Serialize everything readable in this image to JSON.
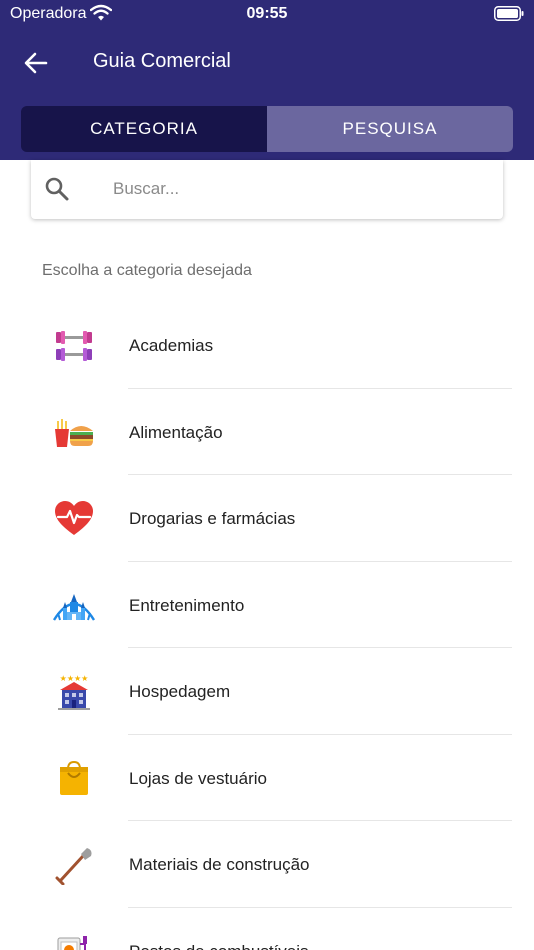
{
  "status_bar": {
    "carrier": "Operadora",
    "time": "09:55"
  },
  "toolbar": {
    "title": "Guia Comercial",
    "back_icon": "arrow-left-icon"
  },
  "tabs": [
    {
      "label": "CATEGORIA",
      "active": true
    },
    {
      "label": "PESQUISA",
      "active": false
    }
  ],
  "search": {
    "placeholder": "Buscar...",
    "value": ""
  },
  "section_label": "Escolha a categoria desejada",
  "categories": [
    {
      "label": "Academias",
      "icon": "dumbbell-icon"
    },
    {
      "label": "Alimentação",
      "icon": "fast-food-icon"
    },
    {
      "label": "Drogarias e farmácias",
      "icon": "heart-pulse-icon"
    },
    {
      "label": "Entretenimento",
      "icon": "castle-icon"
    },
    {
      "label": "Hospedagem",
      "icon": "hotel-icon"
    },
    {
      "label": "Lojas de vestuário",
      "icon": "shopping-bag-icon"
    },
    {
      "label": "Materiais de construção",
      "icon": "shovel-icon"
    },
    {
      "label": "Postos de combustíveis",
      "icon": "fuel-pump-icon"
    }
  ],
  "colors": {
    "header": "#2e2a77",
    "tab_active": "#17144a",
    "tab_inactive": "#6b679f"
  }
}
